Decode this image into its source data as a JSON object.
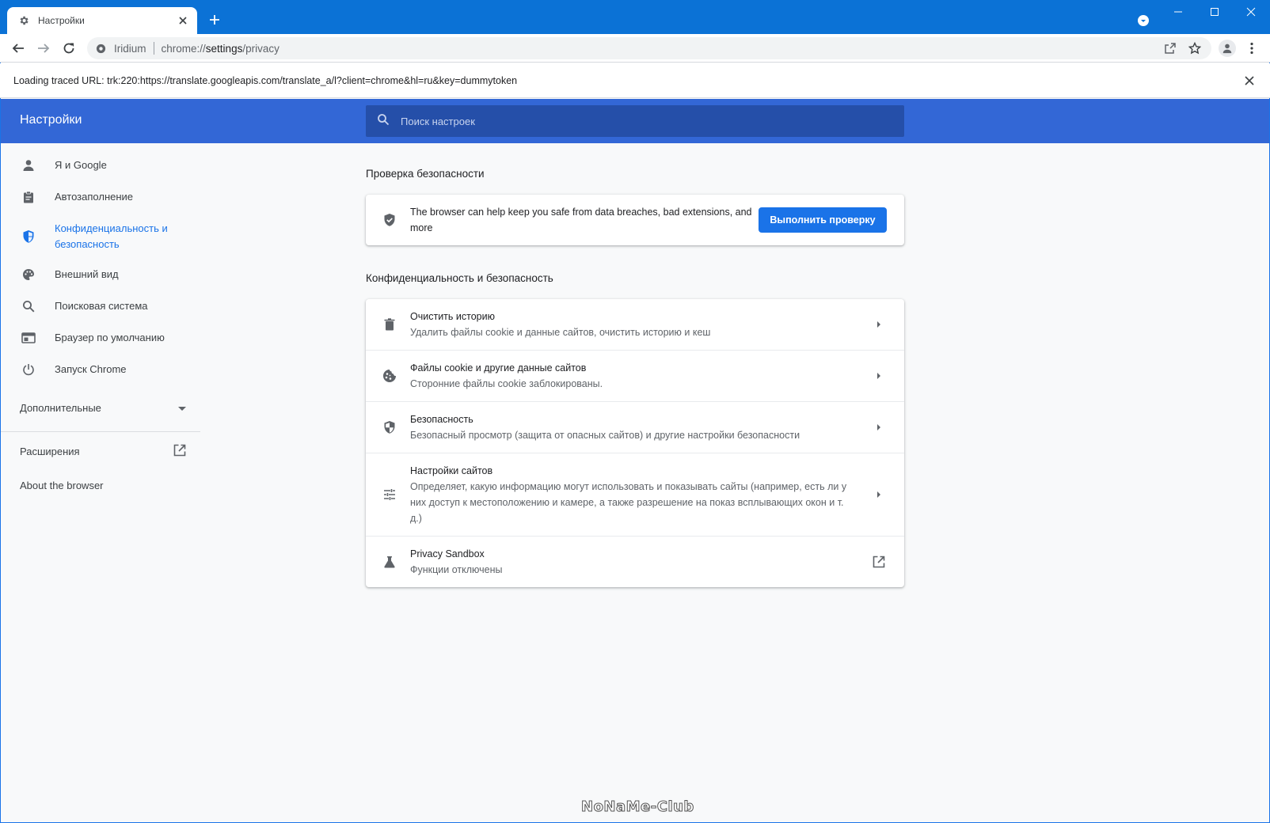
{
  "tab": {
    "title": "Настройки"
  },
  "omnibox": {
    "site_name": "Iridium",
    "url_prefix": "chrome://",
    "url_host": "settings",
    "url_path": "/privacy"
  },
  "infobar": {
    "message": "Loading traced URL: trk:220:https://translate.googleapis.com/translate_a/l?client=chrome&hl=ru&key=dummytoken"
  },
  "header": {
    "title": "Настройки",
    "search_placeholder": "Поиск настроек"
  },
  "sidebar": {
    "items": [
      {
        "label": "Я и Google",
        "icon": "person-icon"
      },
      {
        "label": "Автозаполнение",
        "icon": "clipboard-icon"
      },
      {
        "label": "Конфиденциальность и безопасность",
        "icon": "shield-icon"
      },
      {
        "label": "Внешний вид",
        "icon": "palette-icon"
      },
      {
        "label": "Поисковая система",
        "icon": "search-icon"
      },
      {
        "label": "Браузер по умолчанию",
        "icon": "browser-icon"
      },
      {
        "label": "Запуск Chrome",
        "icon": "power-icon"
      }
    ],
    "advanced": "Дополнительные",
    "extensions": "Расширения",
    "about": "About the browser"
  },
  "safety_check": {
    "title": "Проверка безопасности",
    "text": "The browser can help keep you safe from data breaches, bad extensions, and more",
    "button": "Выполнить проверку"
  },
  "privacy": {
    "title": "Конфиденциальность и безопасность",
    "rows": [
      {
        "title": "Очистить историю",
        "subtitle": "Удалить файлы cookie и данные сайтов, очистить историю и кеш"
      },
      {
        "title": "Файлы cookie и другие данные сайтов",
        "subtitle": "Сторонние файлы cookie заблокированы."
      },
      {
        "title": "Безопасность",
        "subtitle": "Безопасный просмотр (защита от опасных сайтов) и другие настройки безопасности"
      },
      {
        "title": "Настройки сайтов",
        "subtitle": "Определяет, какую информацию могут использовать и показывать сайты (например, есть ли у них доступ к местоположению и камере, а также разрешение на показ всплывающих окон и т. д.)"
      },
      {
        "title": "Privacy Sandbox",
        "subtitle": "Функции отключены"
      }
    ]
  },
  "watermark": "NoNaMe-Club",
  "colors": {
    "accent": "#1a73e8",
    "header": "#3367d6",
    "titlebar": "#0b72d6"
  }
}
